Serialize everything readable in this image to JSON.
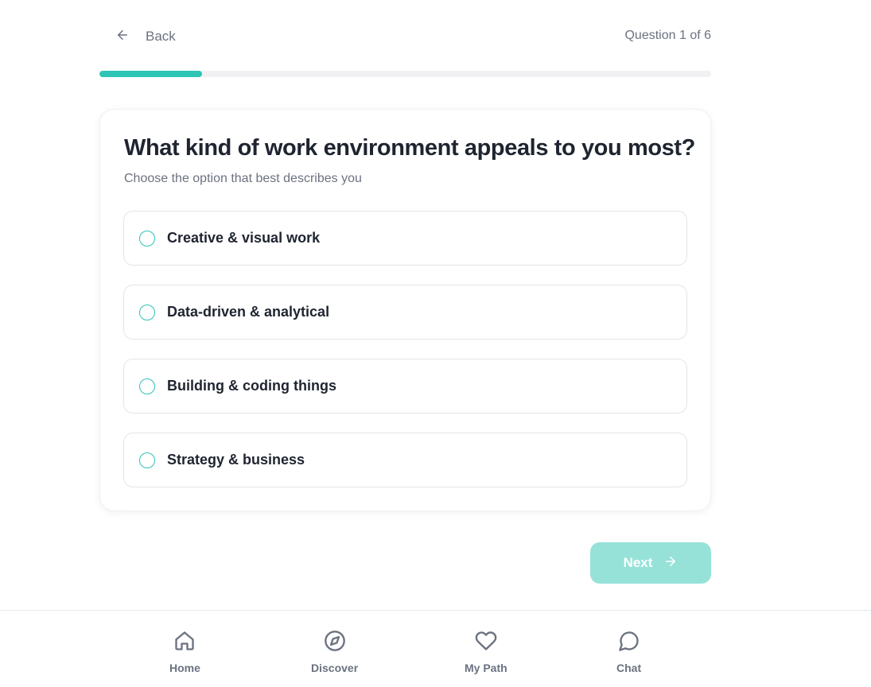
{
  "header": {
    "back_label": "Back",
    "question_counter": "Question 1 of 6"
  },
  "progress": {
    "current": 1,
    "total": 6,
    "fraction": 0.167,
    "color": "#2ec4b6"
  },
  "question": {
    "title": "What kind of work environment appeals to you most?",
    "subtitle": "Choose the option that best describes you",
    "options": [
      {
        "label": "Creative & visual work",
        "selected": false
      },
      {
        "label": "Data-driven & analytical",
        "selected": false
      },
      {
        "label": "Building & coding things",
        "selected": false
      },
      {
        "label": "Strategy & business",
        "selected": false
      }
    ]
  },
  "next_button": {
    "label": "Next",
    "enabled": false,
    "color": "#96e2d9"
  },
  "bottom_nav": {
    "items": [
      {
        "label": "Home",
        "icon": "home-icon"
      },
      {
        "label": "Discover",
        "icon": "compass-icon"
      },
      {
        "label": "My Path",
        "icon": "heart-icon"
      },
      {
        "label": "Chat",
        "icon": "chat-bubble-icon"
      }
    ]
  },
  "colors": {
    "accent": "#2ec4b6",
    "text": "#1f2430",
    "muted": "#6b7280"
  }
}
